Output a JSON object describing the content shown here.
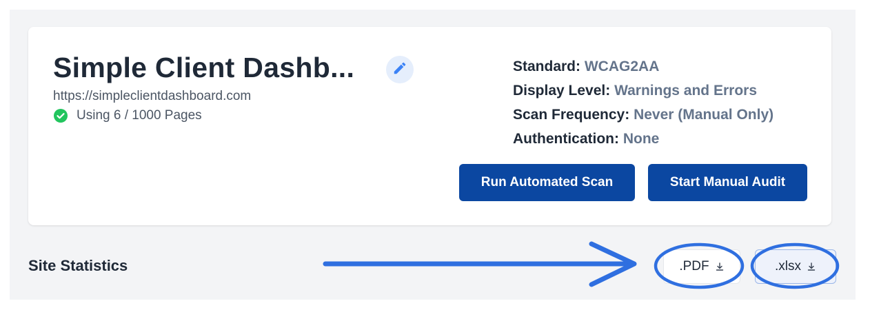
{
  "project": {
    "title": "Simple Client Dashb...",
    "url": "https://simpleclientdashboard.com",
    "usage": "Using 6 / 1000 Pages"
  },
  "meta": [
    {
      "key": "Standard:",
      "value": "WCAG2AA"
    },
    {
      "key": "Display Level:",
      "value": "Warnings and Errors"
    },
    {
      "key": "Scan Frequency:",
      "value": "Never (Manual Only)"
    },
    {
      "key": "Authentication:",
      "value": "None"
    }
  ],
  "actions": {
    "run_scan": "Run Automated Scan",
    "manual_audit": "Start Manual Audit"
  },
  "stats": {
    "label": "Site Statistics",
    "pdf": ".PDF",
    "xlsx": ".xlsx"
  },
  "icons": {
    "edit": "pencil-icon",
    "check": "check-circle-icon",
    "download": "download-icon"
  },
  "colors": {
    "primary": "#0b47a1",
    "annotation": "#2f6fe0",
    "success": "#22c55e"
  }
}
